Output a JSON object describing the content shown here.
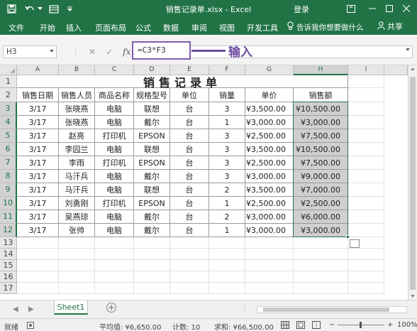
{
  "window": {
    "title": "销售记录单.xlsx - Excel",
    "signin": "登录"
  },
  "menu": {
    "items": [
      "文件",
      "开始",
      "插入",
      "页面布局",
      "公式",
      "数据",
      "审阅",
      "视图",
      "开发工具"
    ],
    "tellme": "告诉我你想要做什么",
    "share": "共享"
  },
  "formula_bar": {
    "name_box": "H3",
    "formula": "=C3*F3",
    "fx": "fx",
    "callout": "输入"
  },
  "grid": {
    "columns": [
      "A",
      "B",
      "C",
      "D",
      "E",
      "F",
      "G",
      "H",
      "I"
    ],
    "selected_column": "H",
    "rows": [
      "1",
      "2",
      "3",
      "4",
      "5",
      "6",
      "7",
      "8",
      "9",
      "10",
      "11",
      "12",
      "13",
      "14",
      "15",
      "16",
      "17"
    ],
    "title": "销售记录单",
    "headers": [
      "销售日期",
      "销售人员",
      "商品名称",
      "规格型号",
      "单位",
      "销量",
      "单价",
      "销售额"
    ],
    "records": [
      [
        "3/17",
        "张晓燕",
        "电脑",
        "联想",
        "台",
        "3",
        "¥3,500.00",
        "¥10,500.00"
      ],
      [
        "3/17",
        "张晓燕",
        "电脑",
        "戴尔",
        "台",
        "1",
        "¥3,000.00",
        "¥3,000.00"
      ],
      [
        "3/17",
        "赵亮",
        "打印机",
        "EPSON",
        "台",
        "3",
        "¥2,500.00",
        "¥7,500.00"
      ],
      [
        "3/17",
        "李园兰",
        "电脑",
        "联想",
        "台",
        "3",
        "¥3,500.00",
        "¥10,500.00"
      ],
      [
        "3/17",
        "李雨",
        "打印机",
        "EPSON",
        "台",
        "3",
        "¥2,500.00",
        "¥7,500.00"
      ],
      [
        "3/17",
        "马汗兵",
        "电脑",
        "戴尔",
        "台",
        "3",
        "¥3,000.00",
        "¥9,000.00"
      ],
      [
        "3/17",
        "马汗兵",
        "电脑",
        "联想",
        "台",
        "2",
        "¥3,500.00",
        "¥7,000.00"
      ],
      [
        "3/17",
        "刘勇刚",
        "打印机",
        "EPSON",
        "台",
        "1",
        "¥2,500.00",
        "¥2,500.00"
      ],
      [
        "3/17",
        "吴燕琼",
        "电脑",
        "戴尔",
        "台",
        "2",
        "¥3,000.00",
        "¥6,000.00"
      ],
      [
        "3/17",
        "张帅",
        "电脑",
        "戴尔",
        "台",
        "1",
        "¥3,000.00",
        "¥3,000.00"
      ]
    ]
  },
  "sheets": {
    "active": "Sheet1"
  },
  "status": {
    "mode": "就绪",
    "average": "平均值: ¥6,650.00",
    "count": "计数: 10",
    "sum": "求和: ¥66,500.00",
    "zoom": "100%"
  },
  "colors": {
    "excel_green": "#217346",
    "callout_purple": "#6e4fa3",
    "selection_fill": "#cfcfcf"
  }
}
